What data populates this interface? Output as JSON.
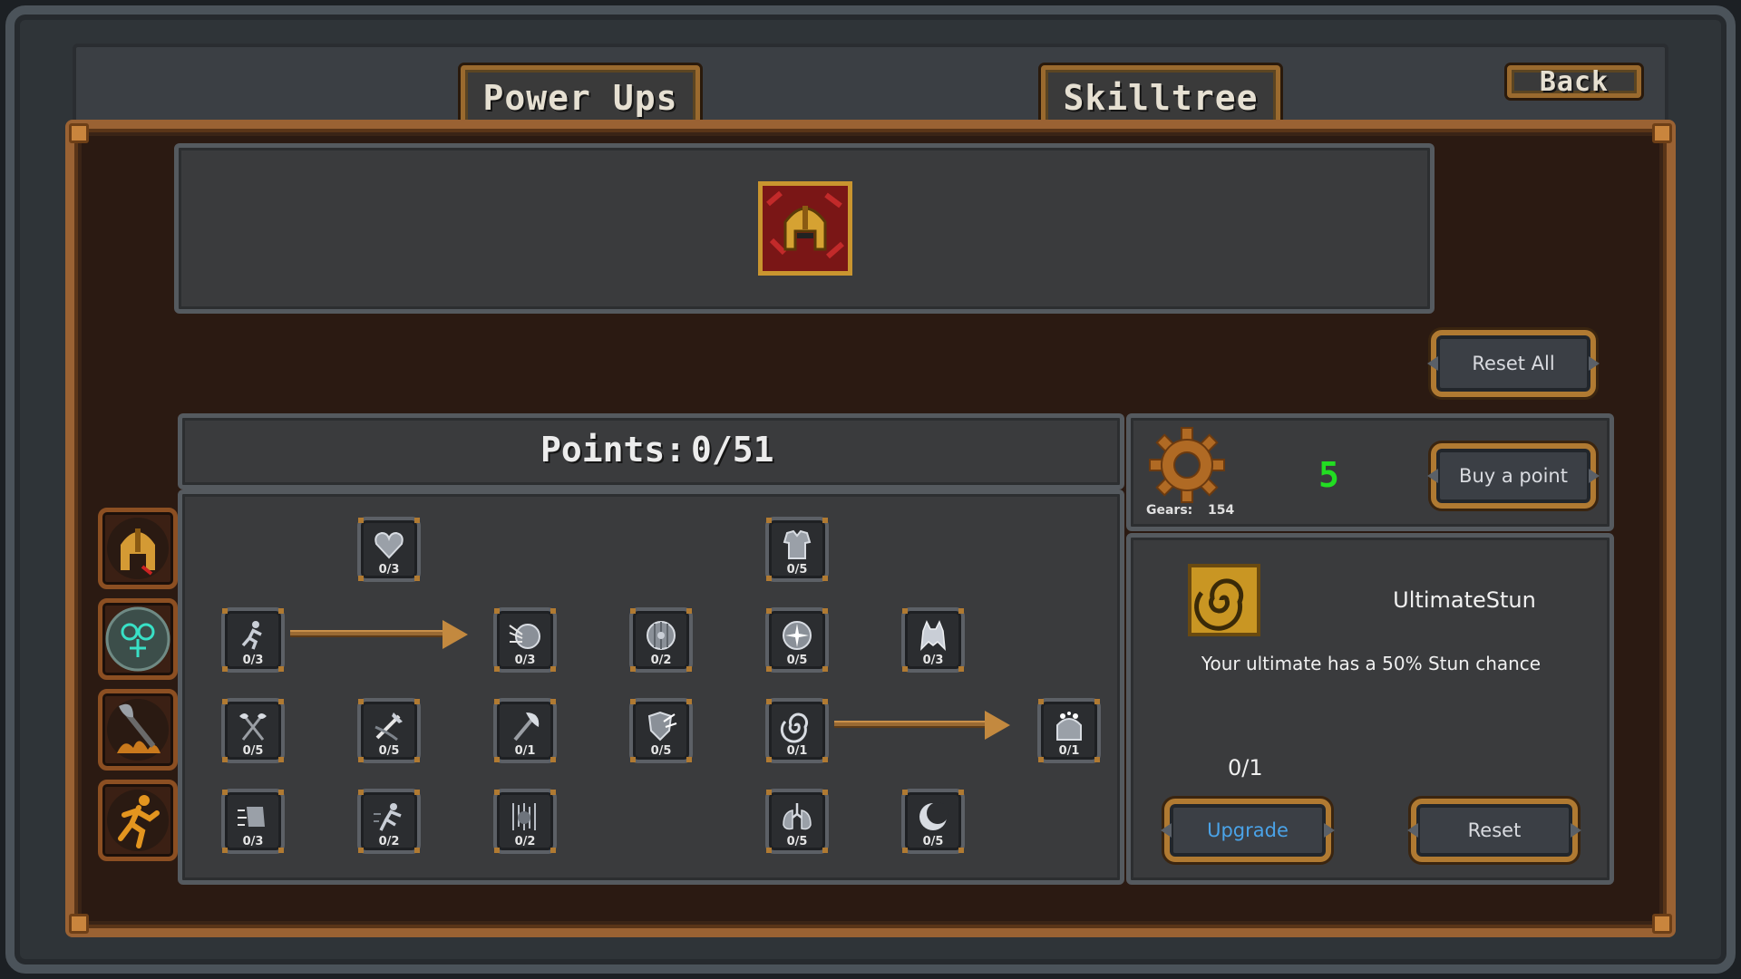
{
  "header": {
    "tab_powerups": "Power Ups",
    "tab_skilltree": "Skilltree",
    "back_label": "Back"
  },
  "class_preview": {
    "icon": "helmet-icon"
  },
  "actions": {
    "reset_all_label": "Reset All",
    "buy_point_label": "Buy a point"
  },
  "points": {
    "label": "Points:",
    "value": "0/51"
  },
  "currency": {
    "icon": "gear-icon",
    "gears_label": "Gears:",
    "gears_value": "154",
    "point_cost": "5",
    "cost_color": "#22dd22"
  },
  "categories": [
    {
      "name": "warrior",
      "icon": "helmet-icon"
    },
    {
      "name": "magic",
      "icon": "rune-orb-icon"
    },
    {
      "name": "weapons",
      "icon": "axe-fire-icon"
    },
    {
      "name": "movement",
      "icon": "running-man-icon"
    }
  ],
  "skills": [
    {
      "count": "0/3",
      "icon": "heart-icon"
    },
    {
      "count": "0/5",
      "icon": "armor-icon"
    },
    {
      "count": "0/3",
      "icon": "runner-icon"
    },
    {
      "count": "0/3",
      "icon": "shield-arrows-icon"
    },
    {
      "count": "0/2",
      "icon": "round-shield-icon"
    },
    {
      "count": "0/5",
      "icon": "shield-spark-icon"
    },
    {
      "count": "0/3",
      "icon": "wolf-icon"
    },
    {
      "count": "0/5",
      "icon": "double-axe-icon"
    },
    {
      "count": "0/5",
      "icon": "sword-slash-icon"
    },
    {
      "count": "0/1",
      "icon": "axe-icon"
    },
    {
      "count": "0/5",
      "icon": "shield-bash-icon"
    },
    {
      "count": "0/1",
      "icon": "spiral-icon"
    },
    {
      "count": "0/1",
      "icon": "stunned-head-icon"
    },
    {
      "count": "0/3",
      "icon": "dash-icon"
    },
    {
      "count": "0/2",
      "icon": "dodge-icon"
    },
    {
      "count": "0/2",
      "icon": "rain-icon"
    },
    {
      "count": "0/5",
      "icon": "lungs-icon"
    },
    {
      "count": "0/5",
      "icon": "crescent-icon"
    }
  ],
  "detail": {
    "icon": "spiral-icon",
    "name": "UltimateStun",
    "description": "Your ultimate has a 50% Stun chance",
    "level": "0/1",
    "upgrade_label": "Upgrade",
    "reset_label": "Reset",
    "upgrade_color": "#4aa3e8"
  }
}
